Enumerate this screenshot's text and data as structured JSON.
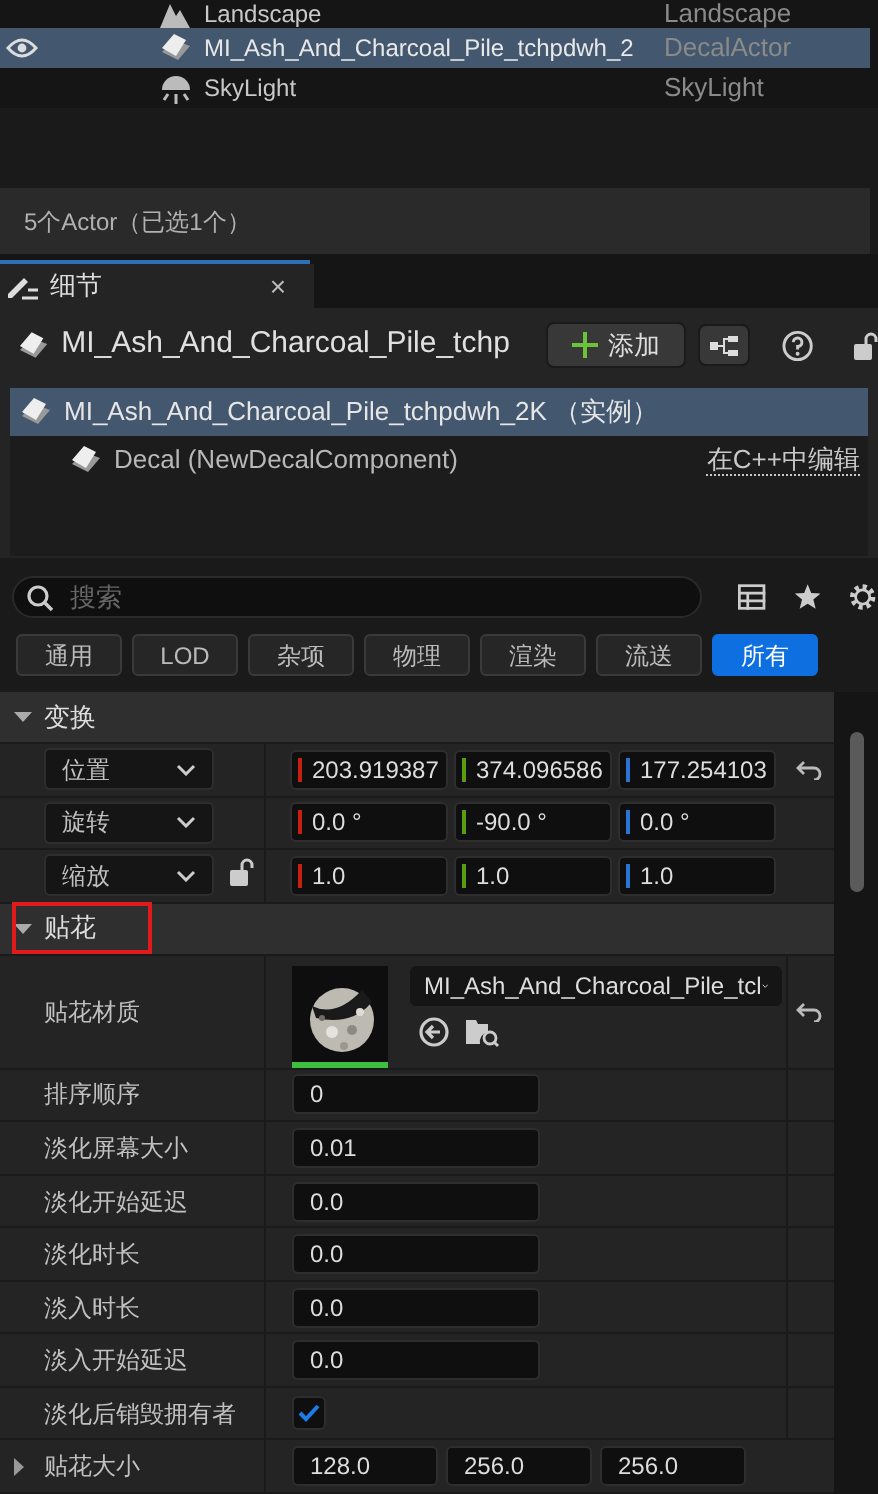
{
  "outliner": {
    "rows": [
      {
        "kind": "landscape",
        "name": "Landscape",
        "type": "Landscape",
        "selected": false,
        "visible": false
      },
      {
        "kind": "decal",
        "name": "MI_Ash_And_Charcoal_Pile_tchpdwh_2",
        "type": "DecalActor",
        "selected": true,
        "visible": true
      },
      {
        "kind": "skylight",
        "name": "SkyLight",
        "type": "SkyLight",
        "selected": false,
        "visible": false
      }
    ],
    "status": "5个Actor（已选1个）"
  },
  "details_tab": {
    "title": "细节",
    "close": "×"
  },
  "header": {
    "title": "MI_Ash_And_Charcoal_Pile_tchp",
    "add_button": "添加"
  },
  "components": [
    {
      "name": "MI_Ash_And_Charcoal_Pile_tchpdwh_2K （实例）",
      "selected": true,
      "children": [
        {
          "name": "Decal (NewDecalComponent)",
          "selected": false,
          "link": "在C++中编辑"
        }
      ]
    }
  ],
  "search": {
    "placeholder": "搜索"
  },
  "filters": [
    {
      "label": "通用",
      "selected": false
    },
    {
      "label": "LOD",
      "selected": false
    },
    {
      "label": "杂项",
      "selected": false
    },
    {
      "label": "物理",
      "selected": false
    },
    {
      "label": "渲染",
      "selected": false
    },
    {
      "label": "流送",
      "selected": false
    },
    {
      "label": "所有",
      "selected": true
    }
  ],
  "sections": [
    {
      "title": "变换",
      "expanded": true,
      "highlighted": false,
      "rows": [
        {
          "kind": "transform",
          "label": "位置",
          "lock": false,
          "resettable": true,
          "values": [
            "203.919387",
            "374.096586",
            "177.254103"
          ]
        },
        {
          "kind": "transform",
          "label": "旋转",
          "lock": false,
          "resettable": false,
          "values": [
            "0.0 °",
            "-90.0 °",
            "0.0 °"
          ]
        },
        {
          "kind": "transform",
          "label": "缩放",
          "lock": true,
          "resettable": false,
          "values": [
            "1.0",
            "1.0",
            "1.0"
          ]
        }
      ]
    },
    {
      "title": "贴花",
      "expanded": true,
      "highlighted": true,
      "rows": [
        {
          "kind": "material",
          "label": "贴花材质",
          "value": "MI_Ash_And_Charcoal_Pile_tcl",
          "resettable": true
        },
        {
          "kind": "number",
          "label": "排序顺序",
          "value": "0"
        },
        {
          "kind": "number",
          "label": "淡化屏幕大小",
          "value": "0.01"
        },
        {
          "kind": "number",
          "label": "淡化开始延迟",
          "value": "0.0"
        },
        {
          "kind": "number",
          "label": "淡化时长",
          "value": "0.0"
        },
        {
          "kind": "number",
          "label": "淡入时长",
          "value": "0.0"
        },
        {
          "kind": "number",
          "label": "淡入开始延迟",
          "value": "0.0"
        },
        {
          "kind": "checkbox",
          "label": "淡化后销毁拥有者",
          "checked": true
        },
        {
          "kind": "vector",
          "label": "贴花大小",
          "expanded": false,
          "values": [
            "128.0",
            "256.0",
            "256.0"
          ]
        }
      ]
    }
  ]
}
